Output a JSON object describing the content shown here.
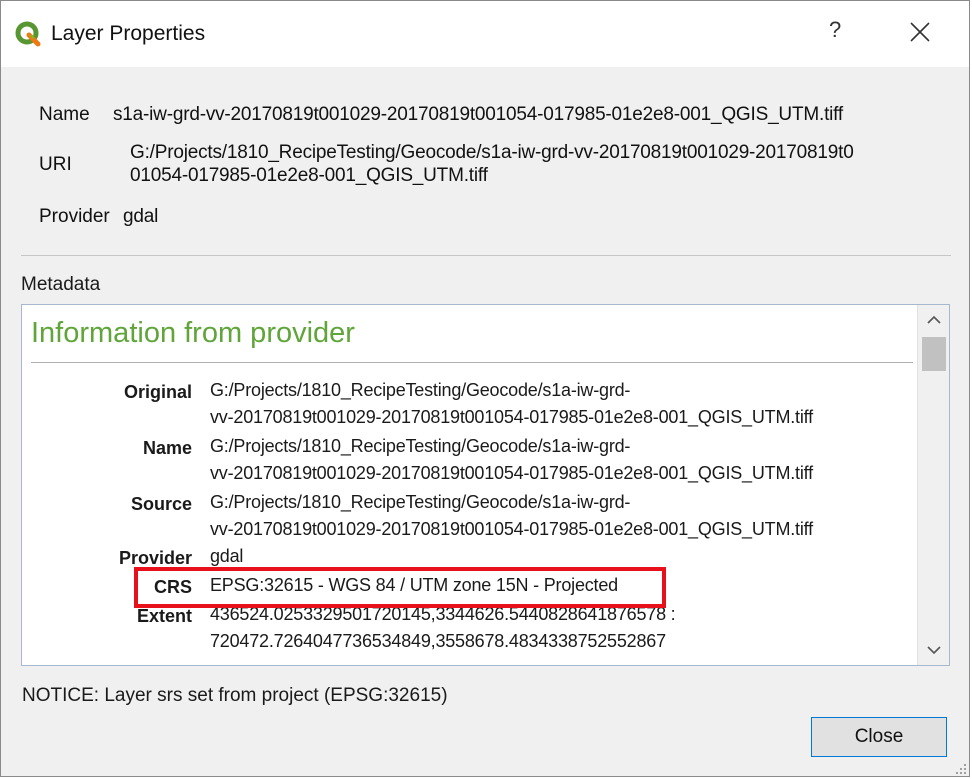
{
  "window": {
    "title": "Layer Properties",
    "help_glyph": "?",
    "icons": {
      "logo": "qgis-logo-icon",
      "close": "close-icon",
      "scroll_up": "chevron-up-icon",
      "scroll_down": "chevron-down-icon"
    }
  },
  "info": {
    "name_label": "Name",
    "name_value": "s1a-iw-grd-vv-20170819t001029-20170819t001054-017985-01e2e8-001_QGIS_UTM.tiff",
    "uri_label": "URI",
    "uri_value_line1": "G:/Projects/1810_RecipeTesting/Geocode/s1a-iw-grd-vv-20170819t001029-20170819t0",
    "uri_value_line2": "01054-017985-01e2e8-001_QGIS_UTM.tiff",
    "provider_label": "Provider",
    "provider_value": "gdal"
  },
  "metadata": {
    "label": "Metadata",
    "heading": "Information from provider",
    "rows": [
      {
        "key": "Original",
        "line1": "G:/Projects/1810_RecipeTesting/Geocode/s1a-iw-grd-",
        "line2": "vv-20170819t001029-20170819t001054-017985-01e2e8-001_QGIS_UTM.tiff"
      },
      {
        "key": "Name",
        "line1": "G:/Projects/1810_RecipeTesting/Geocode/s1a-iw-grd-",
        "line2": "vv-20170819t001029-20170819t001054-017985-01e2e8-001_QGIS_UTM.tiff"
      },
      {
        "key": "Source",
        "line1": "G:/Projects/1810_RecipeTesting/Geocode/s1a-iw-grd-",
        "line2": "vv-20170819t001029-20170819t001054-017985-01e2e8-001_QGIS_UTM.tiff"
      },
      {
        "key": "Provider",
        "line1": "gdal"
      },
      {
        "key": "CRS",
        "line1": "EPSG:32615 - WGS 84 / UTM zone 15N - Projected"
      },
      {
        "key": "Extent",
        "line1": "436524.0253329501720145,3344626.5440828641876578 :",
        "line2": "720472.7264047736534849,3558678.4834338752552867"
      }
    ]
  },
  "notice": "NOTICE: Layer srs set from project (EPSG:32615)",
  "buttons": {
    "close_label": "Close"
  },
  "colors": {
    "heading": "#5fa53a",
    "highlight": "#e8101a",
    "button_border": "#0078d7"
  }
}
